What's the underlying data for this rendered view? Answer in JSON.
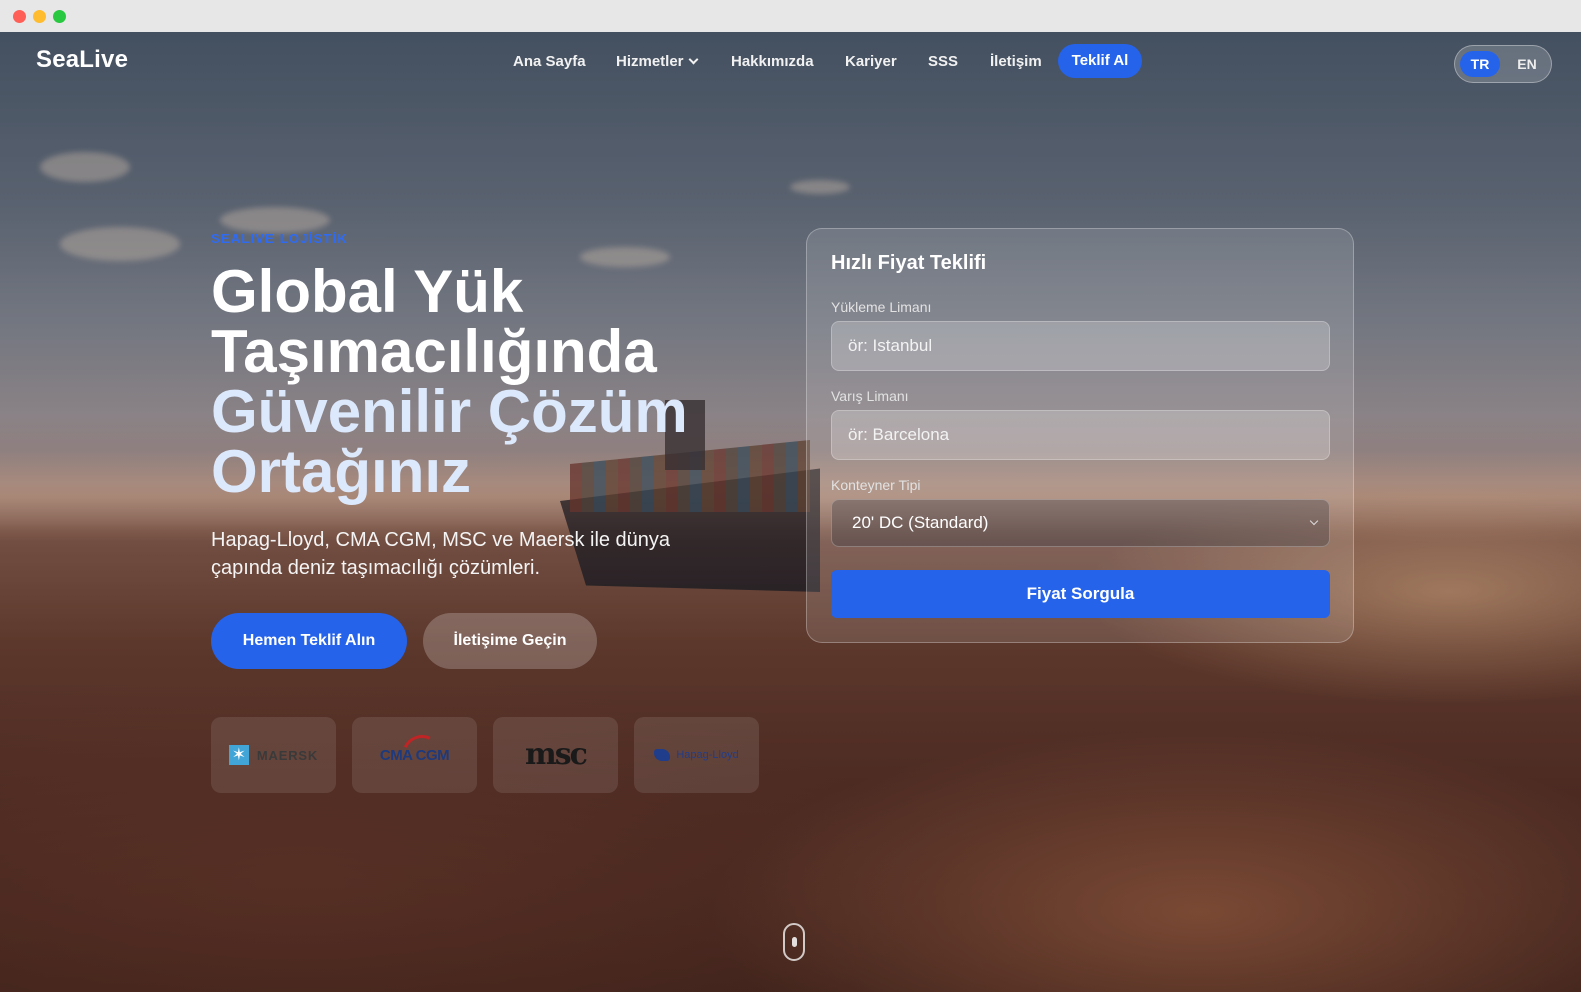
{
  "brand": {
    "name": "SeaLive"
  },
  "nav": {
    "items": [
      {
        "label": "Ana Sayfa"
      },
      {
        "label": "Hizmetler"
      },
      {
        "label": "Hakkımızda"
      },
      {
        "label": "Kariyer"
      },
      {
        "label": "SSS"
      },
      {
        "label": "İletişim"
      }
    ],
    "cta_label": "Teklif Al"
  },
  "language": {
    "active": "TR",
    "other": "EN"
  },
  "hero": {
    "eyebrow": "SEALIVE LOJİSTİK",
    "headline_line1": "Global Yük",
    "headline_line2": "Taşımacılığında",
    "headline_line3": "Güvenilir Çözüm",
    "headline_line4": "Ortağınız",
    "subtitle": "Hapag-Lloyd, CMA CGM, MSC ve Maersk ile dünya çapında deniz taşımacılığı çözümleri.",
    "primary_button": "Hemen Teklif Alın",
    "secondary_button": "İletişime Geçin"
  },
  "carriers": [
    {
      "name": "MAERSK",
      "icon": "maersk-star-icon"
    },
    {
      "name": "CMA CGM",
      "icon": "cma-cgm-logo"
    },
    {
      "name": "msc",
      "icon": "msc-logo"
    },
    {
      "name": "Hapag-Lloyd",
      "icon": "hapag-lloyd-logo"
    }
  ],
  "quote_form": {
    "title": "Hızlı Fiyat Teklifi",
    "loading_port_label": "Yükleme Limanı",
    "loading_port_placeholder": "ör: Istanbul",
    "arrival_port_label": "Varış Limanı",
    "arrival_port_placeholder": "ör: Barcelona",
    "container_type_label": "Konteyner Tipi",
    "container_type_value": "20' DC (Standard)",
    "submit_label": "Fiyat Sorgula"
  },
  "colors": {
    "accent": "#2563eb",
    "headline_accent": "#dce8fb"
  }
}
